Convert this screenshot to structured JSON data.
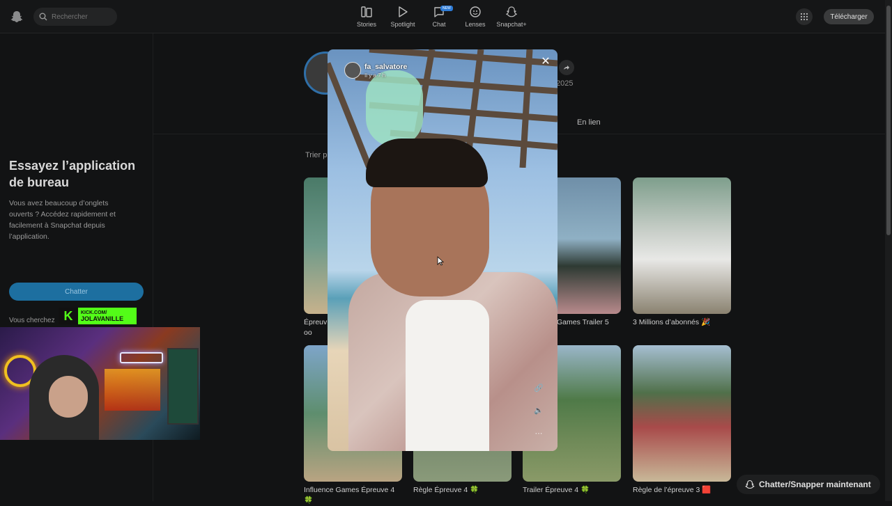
{
  "search": {
    "placeholder": "Rechercher"
  },
  "nav": [
    {
      "label": "Stories",
      "icon": "stories-icon"
    },
    {
      "label": "Spotlight",
      "icon": "spotlight-icon"
    },
    {
      "label": "Chat",
      "icon": "chat-icon",
      "badge": "NEW"
    },
    {
      "label": "Lenses",
      "icon": "lenses-icon"
    },
    {
      "label": "Snapchat+",
      "icon": "snapchat-plus-icon"
    }
  ],
  "header": {
    "download_label": "Télécharger"
  },
  "sidebar": {
    "promo_title": "Essayez l’application de bureau",
    "promo_text": "Vous avez beaucoup d’onglets ouverts ? Accédez rapidement et facilement à Snapchat depuis l’application.",
    "chat_button": "Chatter",
    "looking_text": "Vous cherchez"
  },
  "overlay": {
    "kick_line1": "KICK.COM/",
    "kick_line2": "JOLAVANILLE",
    "kick_letter": "K"
  },
  "profile": {
    "year_text": "2025",
    "tab_linked": "En lien",
    "sort_label": "Trier p"
  },
  "cards": [
    {
      "caption": "Épreuv…  oo"
    },
    {
      "caption": ""
    },
    {
      "caption": "Games Trailer 5"
    },
    {
      "caption": "3 Millions d’abonnés 🎉"
    },
    {
      "caption": "Influence Games Épreuve 4 🍀"
    },
    {
      "caption": "Règle Épreuve 4 🍀"
    },
    {
      "caption": "Trailer Épreuve 4 🍀"
    },
    {
      "caption": "Règle de l’épreuve 3 🟥"
    }
  ],
  "modal": {
    "username": "fa_salvatore",
    "time": "Il y a 7 h",
    "close": "✕"
  },
  "footer": {
    "chat_now": "Chatter/Snapper maintenant"
  },
  "colors": {
    "accent": "#1d6fa0",
    "kick_green": "#53fc18",
    "background": "#121314"
  }
}
